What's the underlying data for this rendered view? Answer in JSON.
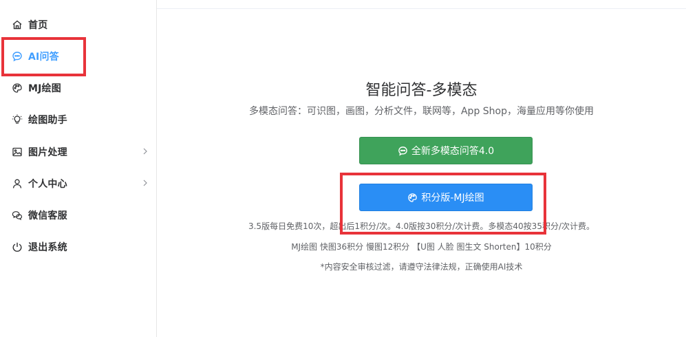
{
  "sidebar": {
    "items": [
      {
        "label": "首页",
        "icon": "home-icon",
        "active": false,
        "chevron": false
      },
      {
        "label": "AI问答",
        "icon": "chat-icon",
        "active": true,
        "chevron": false
      },
      {
        "label": "MJ绘图",
        "icon": "palette-icon",
        "active": false,
        "chevron": false
      },
      {
        "label": "绘图助手",
        "icon": "lightbulb-icon",
        "active": false,
        "chevron": false
      },
      {
        "label": "图片处理",
        "icon": "image-icon",
        "active": false,
        "chevron": true
      },
      {
        "label": "个人中心",
        "icon": "user-icon",
        "active": false,
        "chevron": true
      },
      {
        "label": "微信客服",
        "icon": "wechat-icon",
        "active": false,
        "chevron": false
      },
      {
        "label": "退出系统",
        "icon": "power-icon",
        "active": false,
        "chevron": false
      }
    ]
  },
  "main": {
    "title": "智能问答-多模态",
    "subtitle": "多模态问答：可识图，画图，分析文件，联网等，App Shop，海量应用等你使用",
    "buttons": {
      "multimodal": "全新多模态问答4.0",
      "mj": "积分版-MJ绘图"
    },
    "notes": {
      "pricing": "3.5版每日免费10次，超出后1积分/次。4.0版按30积分/次计费。多模态40按35积分/次计费。",
      "mj_pricing": "MJ绘图 快图36积分 慢图12积分 【U图 人脸 图生文 Shorten】10积分",
      "disclaimer": "*内容安全审核过滤，请遵守法律法规，正确使用AI技术"
    }
  },
  "colors": {
    "accent": "#409eff",
    "green_button": "#3fa35b",
    "blue_button": "#2a8ef5",
    "highlight": "#e8333a"
  }
}
